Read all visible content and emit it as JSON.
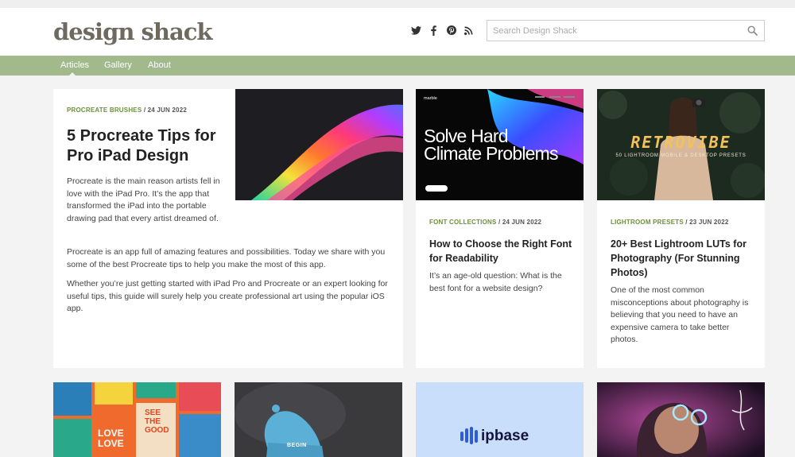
{
  "header": {
    "logo": "design shack",
    "search_placeholder": "Search Design Shack",
    "social": [
      "twitter-icon",
      "facebook-icon",
      "pinterest-icon",
      "rss-icon"
    ]
  },
  "nav": {
    "items": [
      {
        "label": "Articles",
        "active": true
      },
      {
        "label": "Gallery"
      },
      {
        "label": "About"
      }
    ]
  },
  "featured": {
    "category": "PROCREATE BRUSHES",
    "date": "/ 24 JUN 2022",
    "title": "5 Procreate Tips for Pro iPad Design",
    "p1": "Procreate is the main reason artists fell in love with the iPad Pro. It’s the app that transformed the iPad into the portable drawing pad that every artist dreamed of.",
    "p2": "Procreate is an app full of amazing features and possibilities. Today we share with you some of the best Procreate tips to help you make the most of this app.",
    "p3": "Whether you’re just getting started with iPad Pro and Procreate or an expert looking for useful tips, this guide will surely help you create professional art using the popular iOS app."
  },
  "cards": [
    {
      "category": "FONT COLLECTIONS",
      "date": "/ 24 JUN 2022",
      "title": "How to Choose the Right Font for Readability",
      "excerpt": "It’s an age-old question: What is the best font for a website design?",
      "image": {
        "brand": "marble",
        "headline_1": "Solve Hard",
        "headline_2": "Climate Problems"
      }
    },
    {
      "category": "LIGHTROOM PRESETS",
      "date": "/ 23 JUN 2022",
      "title": "20+ Best Lightroom LUTs for Photography (For Stunning Photos)",
      "excerpt": "One of the most common misconceptions about photography is believing that you need to have an expensive camera to take better photos.",
      "image": {
        "headline": "RETROVIBE",
        "sub": "50 LIGHTROOM MOBILE & DESKTOP PRESETS"
      }
    }
  ],
  "bottom_images": {
    "poster_words": [
      "SEE",
      "THE",
      "GOOD",
      "LOVE",
      "LOVE"
    ],
    "beanie_text": "BEGIN",
    "ipbase_logo": "ipbase"
  },
  "colors": {
    "nav_green": "#a2b98c",
    "category_green": "#6b9040",
    "logo_gray": "#6e6a60"
  }
}
